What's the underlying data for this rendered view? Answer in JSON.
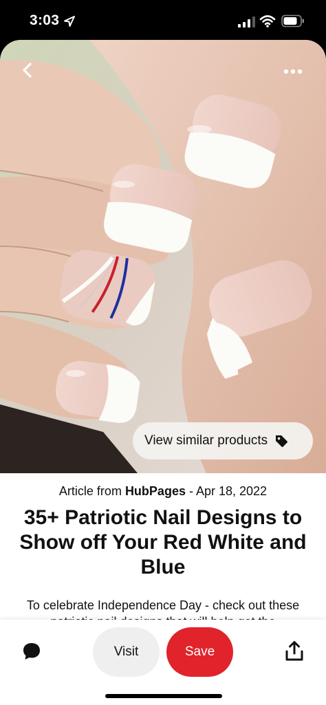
{
  "status_bar": {
    "time": "3:03"
  },
  "pin_image": {
    "back_icon": "chevron-left-icon",
    "more_icon": "ellipsis-icon",
    "similar_button_label": "View similar products",
    "similar_button_icon": "tag-icon"
  },
  "content": {
    "source_prefix": "Article from ",
    "source_site": "HubPages",
    "source_date": " - Apr 18, 2022",
    "title": "35+ Patriotic Nail Designs to Show off Your Red White and Blue",
    "description": "To celebrate Independence Day - check out these patriotic nail designs that will help get the"
  },
  "action_bar": {
    "comment_icon": "speech-bubble-icon",
    "visit_label": "Visit",
    "save_label": "Save",
    "share_icon": "share-icon"
  },
  "colors": {
    "save_red": "#e1232b",
    "visit_gray": "#efefef",
    "nail_tip_white": "#fbfbf8",
    "skin": "#e6c2ae"
  }
}
